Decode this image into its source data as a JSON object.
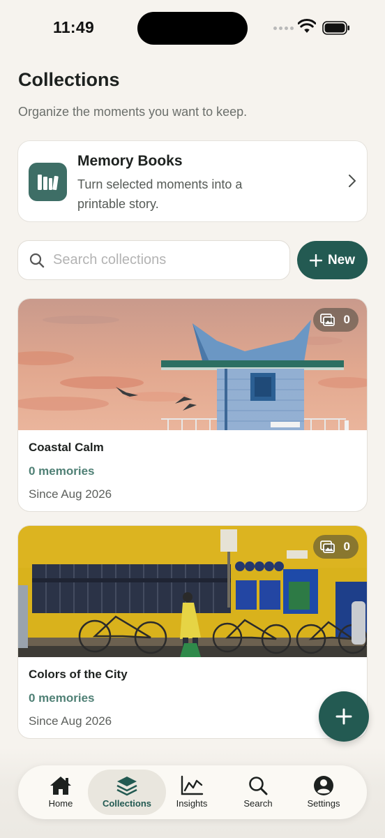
{
  "status_bar": {
    "time": "11:49"
  },
  "header": {
    "title": "Collections",
    "subtitle": "Organize the moments you want to keep."
  },
  "memory_books": {
    "title": "Memory Books",
    "description": "Turn selected moments into a printable story.",
    "icon": "books-icon"
  },
  "search": {
    "placeholder": "Search collections",
    "value": ""
  },
  "new_button": {
    "label": "New",
    "icon": "plus-icon"
  },
  "collections": [
    {
      "title": "Coastal Calm",
      "count_label": "0 memories",
      "since": "Since Aug 2026",
      "photo_count": "0"
    },
    {
      "title": "Colors of the City",
      "count_label": "0 memories",
      "since": "Since Aug 2026",
      "photo_count": "0"
    }
  ],
  "fab": {
    "icon": "plus-icon"
  },
  "tabs": [
    {
      "label": "Home",
      "icon": "home-icon",
      "active": false
    },
    {
      "label": "Collections",
      "icon": "layers-icon",
      "active": true
    },
    {
      "label": "Insights",
      "icon": "chart-icon",
      "active": false
    },
    {
      "label": "Search",
      "icon": "search-icon",
      "active": false
    },
    {
      "label": "Settings",
      "icon": "profile-icon",
      "active": false
    }
  ],
  "colors": {
    "accent": "#235a52",
    "accent_text": "#4f8075",
    "background": "#f6f3ee",
    "card": "#ffffff"
  }
}
